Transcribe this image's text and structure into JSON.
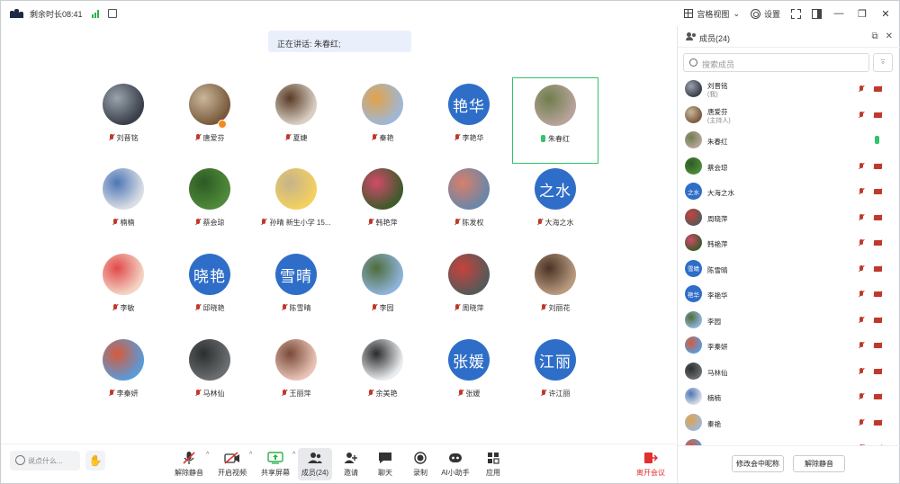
{
  "titlebar": {
    "timer": "剩余时长08:41",
    "view_label": "宫格视图",
    "settings_label": "设置"
  },
  "stage": {
    "speaking_text": "正在讲话: 朱春红;",
    "tiles": [
      {
        "name": "刘晋铭",
        "mic": "muted",
        "avatar": {
          "kind": "photo",
          "c1": "#3a3f4a",
          "c2": "#9aa3ad"
        }
      },
      {
        "name": "唐爱芬",
        "mic": "muted",
        "host": true,
        "avatar": {
          "kind": "photo",
          "c1": "#7a5a3c",
          "c2": "#c9b79c"
        }
      },
      {
        "name": "夏婕",
        "mic": "muted",
        "avatar": {
          "kind": "photo",
          "c1": "#d8cfc3",
          "c2": "#5a3b26"
        }
      },
      {
        "name": "秦艳",
        "mic": "muted",
        "avatar": {
          "kind": "photo",
          "c1": "#9fb7d6",
          "c2": "#e3a24a"
        }
      },
      {
        "name": "李艳华",
        "mic": "muted",
        "avatar": {
          "kind": "text",
          "text": "艳华"
        }
      },
      {
        "name": "朱春红",
        "mic": "on",
        "active": true,
        "avatar": {
          "kind": "photo",
          "c1": "#b7a39a",
          "c2": "#6f7e4c"
        }
      },
      {
        "name": "楠楠",
        "mic": "muted",
        "avatar": {
          "kind": "photo",
          "c1": "#d9dde5",
          "c2": "#4d76b5"
        }
      },
      {
        "name": "蔡会琼",
        "mic": "muted",
        "avatar": {
          "kind": "photo",
          "c1": "#4f8a3a",
          "c2": "#2d5a24"
        }
      },
      {
        "name": "孙晴  新生小学  15...",
        "mic": "muted",
        "avatar": {
          "kind": "photo",
          "c1": "#f3d060",
          "c2": "#c5b38c"
        }
      },
      {
        "name": "韩艳萍",
        "mic": "muted",
        "avatar": {
          "kind": "photo",
          "c1": "#3f5a2c",
          "c2": "#d24a6a"
        }
      },
      {
        "name": "陈发权",
        "mic": "muted",
        "avatar": {
          "kind": "photo",
          "c1": "#6b86a8",
          "c2": "#d87f6a"
        }
      },
      {
        "name": "大海之水",
        "mic": "muted",
        "avatar": {
          "kind": "text",
          "text": "之水"
        }
      },
      {
        "name": "李敏",
        "mic": "muted",
        "avatar": {
          "kind": "photo",
          "c1": "#f4d3c4",
          "c2": "#e04a4a"
        }
      },
      {
        "name": "邱晓艳",
        "mic": "muted",
        "avatar": {
          "kind": "text",
          "text": "晓艳"
        }
      },
      {
        "name": "陈雪晴",
        "mic": "muted",
        "avatar": {
          "kind": "text",
          "text": "雪晴"
        }
      },
      {
        "name": "李园",
        "mic": "muted",
        "avatar": {
          "kind": "photo",
          "c1": "#8eb3d9",
          "c2": "#4f6d3a"
        }
      },
      {
        "name": "周晓萍",
        "mic": "muted",
        "avatar": {
          "kind": "photo",
          "c1": "#555a58",
          "c2": "#c9413c"
        }
      },
      {
        "name": "刘丽花",
        "mic": "muted",
        "avatar": {
          "kind": "photo",
          "c1": "#b99a7f",
          "c2": "#4a3326"
        }
      },
      {
        "name": "李秦妍",
        "mic": "muted",
        "avatar": {
          "kind": "photo",
          "c1": "#5a9ad8",
          "c2": "#d65a3a"
        }
      },
      {
        "name": "马林仙",
        "mic": "muted",
        "avatar": {
          "kind": "photo",
          "c1": "#6a6e70",
          "c2": "#2c2f30"
        }
      },
      {
        "name": "王丽萍",
        "mic": "muted",
        "avatar": {
          "kind": "photo",
          "c1": "#e8c3b5",
          "c2": "#7a4a3a"
        }
      },
      {
        "name": "余美艳",
        "mic": "muted",
        "avatar": {
          "kind": "photo",
          "c1": "#e9ecef",
          "c2": "#2a2a2a"
        }
      },
      {
        "name": "张媛",
        "mic": "muted",
        "avatar": {
          "kind": "text",
          "text": "张媛"
        }
      },
      {
        "name": "许江丽",
        "mic": "muted",
        "avatar": {
          "kind": "text",
          "text": "江丽"
        }
      }
    ]
  },
  "toolbar": {
    "chat_placeholder": "说点什么...",
    "hand_icon": "hand-icon",
    "buttons": [
      {
        "id": "unmute",
        "label": "解除静音",
        "icon": "mic-muted-icon",
        "caret": true
      },
      {
        "id": "video",
        "label": "开启视频",
        "icon": "camera-off-icon",
        "caret": true
      },
      {
        "id": "share",
        "label": "共享屏幕",
        "icon": "screen-share-icon",
        "caret": true
      },
      {
        "id": "members",
        "label": "成员(24)",
        "icon": "members-icon",
        "selected": true
      },
      {
        "id": "invite",
        "label": "邀请",
        "icon": "invite-icon"
      },
      {
        "id": "chat",
        "label": "聊天",
        "icon": "chat-icon"
      },
      {
        "id": "record",
        "label": "录制",
        "icon": "record-icon"
      },
      {
        "id": "ai",
        "label": "AI小助手",
        "icon": "ai-assistant-icon"
      },
      {
        "id": "apps",
        "label": "应用",
        "icon": "apps-icon"
      }
    ],
    "leave_label": "离开会议"
  },
  "panel": {
    "title": "成员(24)",
    "search_placeholder": "搜索成员",
    "members": [
      {
        "name": "刘晋铭",
        "role": "(我)",
        "mic": "muted",
        "video": "off",
        "avatar": {
          "kind": "photo",
          "c1": "#3a3f4a",
          "c2": "#9aa3ad"
        }
      },
      {
        "name": "唐爱芬",
        "role": "(主持人)",
        "mic": "muted",
        "video": "off",
        "avatar": {
          "kind": "photo",
          "c1": "#7a5a3c",
          "c2": "#c9b79c"
        }
      },
      {
        "name": "朱春红",
        "mic": "on",
        "video": "none",
        "avatar": {
          "kind": "photo",
          "c1": "#b7a39a",
          "c2": "#6f7e4c"
        }
      },
      {
        "name": "蔡会琼",
        "mic": "muted",
        "video": "off",
        "avatar": {
          "kind": "photo",
          "c1": "#4f8a3a",
          "c2": "#2d5a24"
        }
      },
      {
        "name": "大海之水",
        "mic": "muted",
        "video": "off",
        "avatar": {
          "kind": "text",
          "text": "之水"
        }
      },
      {
        "name": "周晓萍",
        "mic": "muted",
        "video": "off",
        "avatar": {
          "kind": "photo",
          "c1": "#555a58",
          "c2": "#c9413c"
        }
      },
      {
        "name": "韩艳萍",
        "mic": "muted",
        "video": "off",
        "avatar": {
          "kind": "photo",
          "c1": "#3f5a2c",
          "c2": "#d24a6a"
        }
      },
      {
        "name": "陈雪晴",
        "mic": "muted",
        "video": "off",
        "avatar": {
          "kind": "text",
          "text": "雪晴"
        }
      },
      {
        "name": "李艳华",
        "mic": "muted",
        "video": "off",
        "avatar": {
          "kind": "text",
          "text": "艳华"
        }
      },
      {
        "name": "李园",
        "mic": "muted",
        "video": "off",
        "avatar": {
          "kind": "photo",
          "c1": "#8eb3d9",
          "c2": "#4f6d3a"
        }
      },
      {
        "name": "李秦妍",
        "mic": "muted",
        "video": "off",
        "avatar": {
          "kind": "photo",
          "c1": "#5a9ad8",
          "c2": "#d65a3a"
        }
      },
      {
        "name": "马林仙",
        "mic": "muted",
        "video": "off",
        "avatar": {
          "kind": "photo",
          "c1": "#6a6e70",
          "c2": "#2c2f30"
        }
      },
      {
        "name": "楠楠",
        "mic": "muted",
        "video": "off",
        "avatar": {
          "kind": "photo",
          "c1": "#d9dde5",
          "c2": "#4d76b5"
        }
      },
      {
        "name": "秦艳",
        "mic": "muted",
        "video": "off",
        "avatar": {
          "kind": "photo",
          "c1": "#9fb7d6",
          "c2": "#e3a24a"
        }
      },
      {
        "name": "",
        "mic": "muted",
        "video": "off",
        "avatar": {
          "kind": "photo",
          "c1": "#5a9ad8",
          "c2": "#d65a3a"
        }
      }
    ],
    "rename_label": "修改会中昵称",
    "unmute_all_label": "解除静音"
  },
  "colors": {
    "accent_blue": "#2f6ec8",
    "muted_red": "#c0392b",
    "mic_green": "#34c26a",
    "leave_red": "#e0302f",
    "active_border": "#34c26a"
  }
}
